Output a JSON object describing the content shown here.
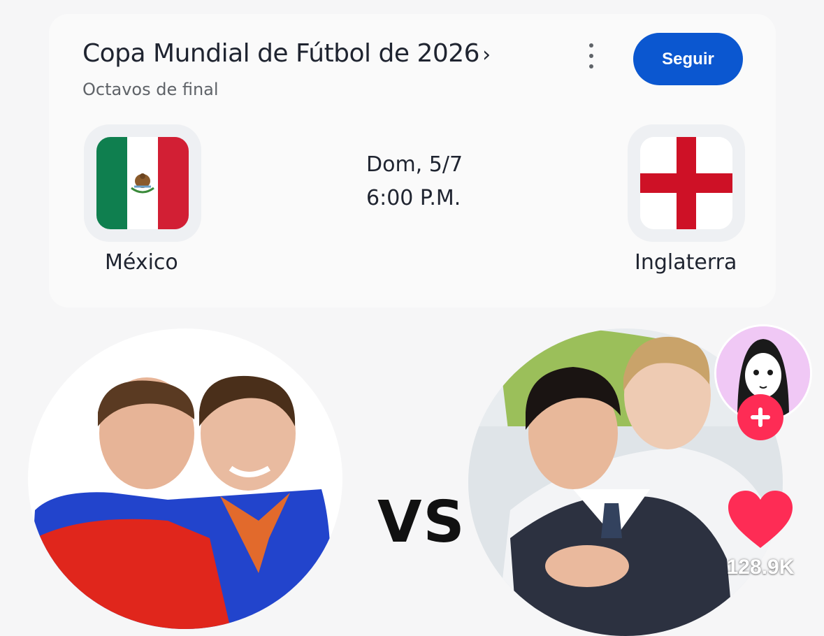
{
  "header": {
    "title": "Copa Mundial de Fútbol de 2026",
    "title_chevron": "›",
    "subtitle": "Octavos de final",
    "menu_icon": "more-vert-icon",
    "follow_label": "Seguir"
  },
  "match": {
    "home": {
      "name": "México",
      "flag_colors": [
        "#0f7f4f",
        "#ffffff",
        "#d21f34"
      ]
    },
    "away": {
      "name": "Inglaterra",
      "flag_colors": [
        "#ffffff",
        "#ce1126"
      ]
    },
    "date": "Dom, 5/7",
    "time": "6:00 P.M."
  },
  "overlay": {
    "vs": "VS",
    "likes": "128.9K",
    "like_icon": "heart-icon",
    "add_icon": "plus-icon",
    "avatar_icon": "profile-avatar-icon",
    "accent": "#fe2c55",
    "primary": "#0b57d0"
  }
}
